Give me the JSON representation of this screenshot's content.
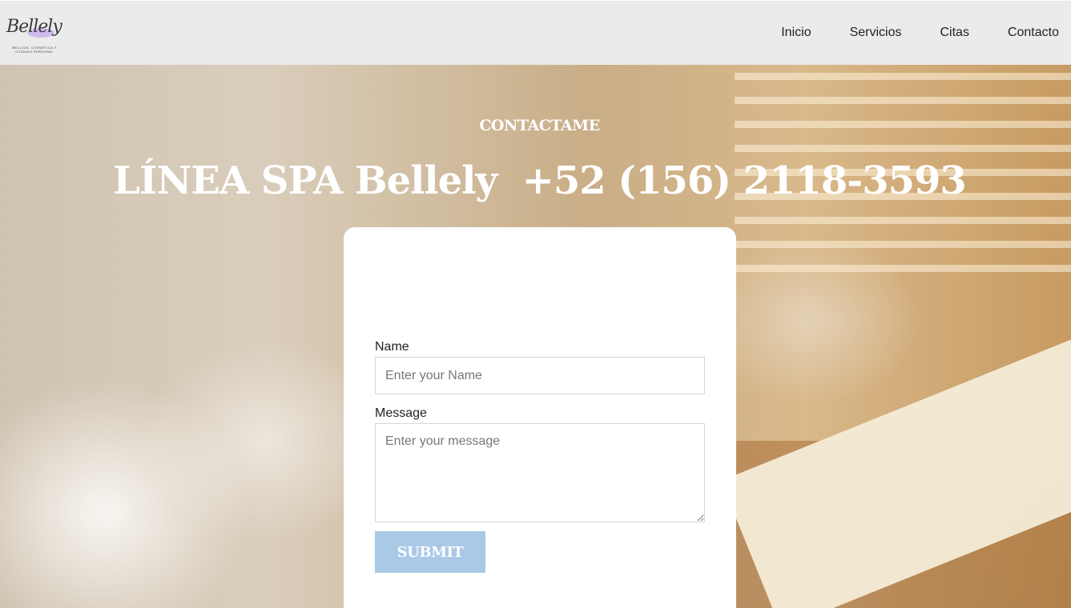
{
  "header": {
    "logo": {
      "script_text": "Bellely",
      "tagline": "BELLEZA, COSMÉTICA Y CUIDADO PERSONAL"
    },
    "nav": [
      {
        "label": "Inicio"
      },
      {
        "label": "Servicios"
      },
      {
        "label": "Citas"
      },
      {
        "label": "Contacto"
      }
    ]
  },
  "hero": {
    "subtitle": "CONTACTAME",
    "title": "LÍNEA SPA Bellely  +52 (156) 2118-3593"
  },
  "form": {
    "name_label": "Name",
    "name_placeholder": "Enter your Name",
    "name_value": "",
    "message_label": "Message",
    "message_placeholder": "Enter your message",
    "message_value": "",
    "submit_label": "SUBMIT"
  },
  "colors": {
    "header_bg": "#ebebeb",
    "submit_bg": "#a9c9e7",
    "logo_accent": "#cbb3ef"
  }
}
